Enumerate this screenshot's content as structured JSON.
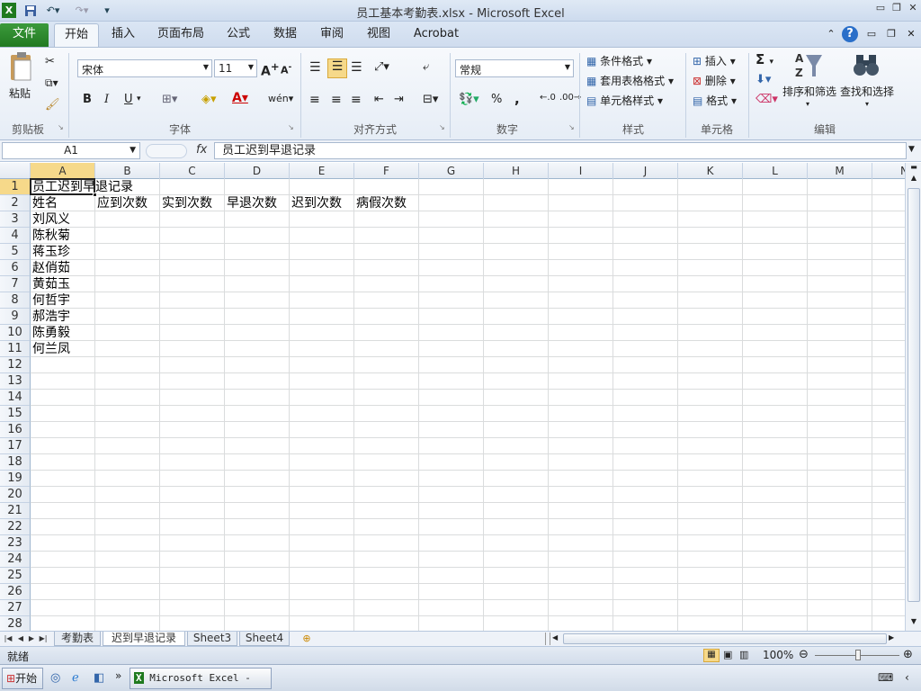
{
  "window": {
    "title": "员工基本考勤表.xlsx - Microsoft Excel"
  },
  "tabs": {
    "file": "文件",
    "home": "开始",
    "insert": "插入",
    "layout": "页面布局",
    "formulas": "公式",
    "data": "数据",
    "review": "审阅",
    "view": "视图",
    "acrobat": "Acrobat"
  },
  "ribbon": {
    "clipboard": {
      "paste": "粘贴",
      "label": "剪贴板"
    },
    "font": {
      "name": "宋体",
      "size": "11",
      "label": "字体",
      "bold": "B",
      "italic": "I",
      "underline": "U",
      "grow": "A",
      "shrink": "A"
    },
    "alignment": {
      "label": "对齐方式"
    },
    "number": {
      "format": "常规",
      "label": "数字",
      "percent": "%",
      "comma": ","
    },
    "styles": {
      "conditional": "条件格式",
      "table": "套用表格格式",
      "cell_styles": "单元格样式",
      "label": "样式"
    },
    "cells": {
      "insert": "插入",
      "delete": "删除",
      "format": "格式",
      "label": "单元格"
    },
    "editing": {
      "sort": "排序和筛选",
      "find": "查找和选择",
      "label": "编辑",
      "sigma": "Σ"
    }
  },
  "formula_bar": {
    "name_box": "A1",
    "fx": "fx",
    "content": "员工迟到早退记录"
  },
  "columns": [
    "A",
    "B",
    "C",
    "D",
    "E",
    "F",
    "G",
    "H",
    "I",
    "J",
    "K",
    "L",
    "M",
    "N"
  ],
  "rows": [
    "1",
    "2",
    "3",
    "4",
    "5",
    "6",
    "7",
    "8",
    "9",
    "10",
    "11",
    "12",
    "13",
    "14",
    "15",
    "16",
    "17",
    "18",
    "19",
    "20",
    "21",
    "22",
    "23",
    "24",
    "25",
    "26",
    "27",
    "28"
  ],
  "cells": {
    "A1": "员工迟到早退记录",
    "A2": "姓名",
    "B2": "应到次数",
    "C2": "实到次数",
    "D2": "早退次数",
    "E2": "迟到次数",
    "F2": "病假次数",
    "A3": "刘风义",
    "A4": "陈秋菊",
    "A5": "蒋玉珍",
    "A6": "赵俏茹",
    "A7": "黄茹玉",
    "A8": "何哲宇",
    "A9": "郝浩宇",
    "A10": "陈勇毅",
    "A11": "何兰凤"
  },
  "sheets": [
    "考勤表",
    "迟到早退记录",
    "Sheet3",
    "Sheet4"
  ],
  "active_sheet": "迟到早退记录",
  "status": {
    "ready": "就绪",
    "zoom": "100%"
  },
  "taskbar": {
    "start": "开始",
    "app": "Microsoft Excel - ..."
  },
  "colors": {
    "file_tab": "#217a21",
    "selection": "#f6d98a"
  }
}
